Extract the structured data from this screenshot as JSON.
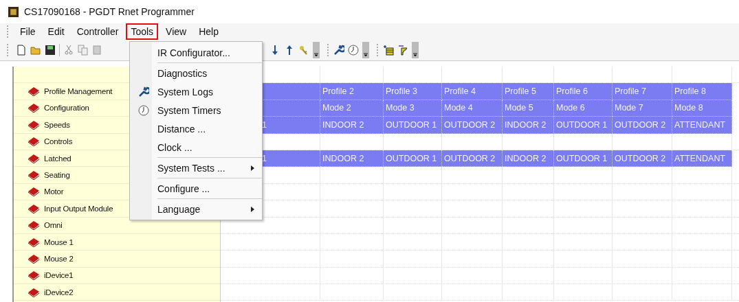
{
  "window": {
    "title": "CS17090168 - PGDT Rnet Programmer"
  },
  "menu_bar": [
    {
      "label": "File",
      "selected": false
    },
    {
      "label": "Edit",
      "selected": false
    },
    {
      "label": "Controller",
      "selected": false
    },
    {
      "label": "Tools",
      "selected": true
    },
    {
      "label": "View",
      "selected": false
    },
    {
      "label": "Help",
      "selected": false
    }
  ],
  "tools_menu": [
    {
      "kind": "item",
      "label": "IR Configurator...",
      "submenu": false
    },
    {
      "kind": "separator"
    },
    {
      "kind": "item",
      "label": "Diagnostics",
      "submenu": false
    },
    {
      "kind": "item",
      "label": "System Logs",
      "submenu": false
    },
    {
      "kind": "item",
      "label": "System Timers",
      "submenu": false
    },
    {
      "kind": "item",
      "label": "Distance ...",
      "submenu": false
    },
    {
      "kind": "item",
      "label": "Clock ...",
      "submenu": false
    },
    {
      "kind": "separator"
    },
    {
      "kind": "item",
      "label": "System Tests ...",
      "submenu": true
    },
    {
      "kind": "separator"
    },
    {
      "kind": "item",
      "label": "Configure ...",
      "submenu": false
    },
    {
      "kind": "separator"
    },
    {
      "kind": "item",
      "label": "Language",
      "submenu": true
    }
  ],
  "sidebar": {
    "items": [
      "Profile Management",
      "Configuration",
      "Speeds",
      "Controls",
      "Latched",
      "Seating",
      "Motor",
      "Input Output Module",
      "Omni",
      "Mouse 1",
      "Mouse 2",
      "iDevice1",
      "iDevice2"
    ]
  },
  "grid": {
    "rows": [
      {
        "selected": true,
        "cells": [
          "Profile 2",
          "Profile 3",
          "Profile 4",
          "Profile 5",
          "Profile 6",
          "Profile 7",
          "Profile 8"
        ]
      },
      {
        "selected": true,
        "cells": [
          "Mode 2",
          "Mode 3",
          "Mode 4",
          "Mode 5",
          "Mode 6",
          "Mode 7",
          "Mode 8"
        ]
      },
      {
        "selected": true,
        "column_1": "1",
        "cells": [
          "INDOOR 2",
          "OUTDOOR 1",
          "OUTDOOR 2",
          "INDOOR 2",
          "OUTDOOR 1",
          "OUTDOOR 2",
          "ATTENDANT"
        ]
      },
      {
        "selected": false
      },
      {
        "selected": true,
        "column_1": "1",
        "cells": [
          "INDOOR 2",
          "OUTDOOR 1",
          "OUTDOOR 2",
          "INDOOR 2",
          "OUTDOOR 1",
          "OUTDOOR 2",
          "ATTENDANT"
        ]
      }
    ]
  }
}
